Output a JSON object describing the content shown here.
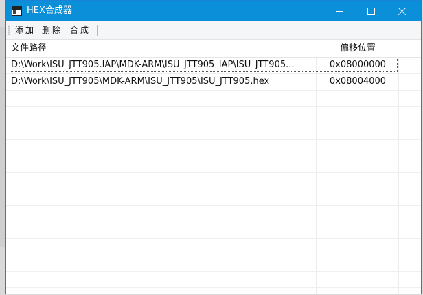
{
  "window": {
    "title": "HEX合成器"
  },
  "toolbar": {
    "add_label": "添加",
    "delete_label": "删除",
    "merge_label": "合成"
  },
  "table": {
    "columns": [
      "文件路径",
      "偏移位置"
    ],
    "rows": [
      {
        "path": "D:\\Work\\ISU_JTT905.IAP\\MDK-ARM\\ISU_JTT905_IAP\\ISU_JTT905...",
        "offset": "0x08000000",
        "selected": true
      },
      {
        "path": "D:\\Work\\ISU_JTT905\\MDK-ARM\\ISU_JTT905\\ISU_JTT905.hex",
        "offset": "0x08004000",
        "selected": false
      }
    ]
  },
  "colors": {
    "titlebar": "#0b8fd9",
    "window_border": "#1883d7"
  }
}
